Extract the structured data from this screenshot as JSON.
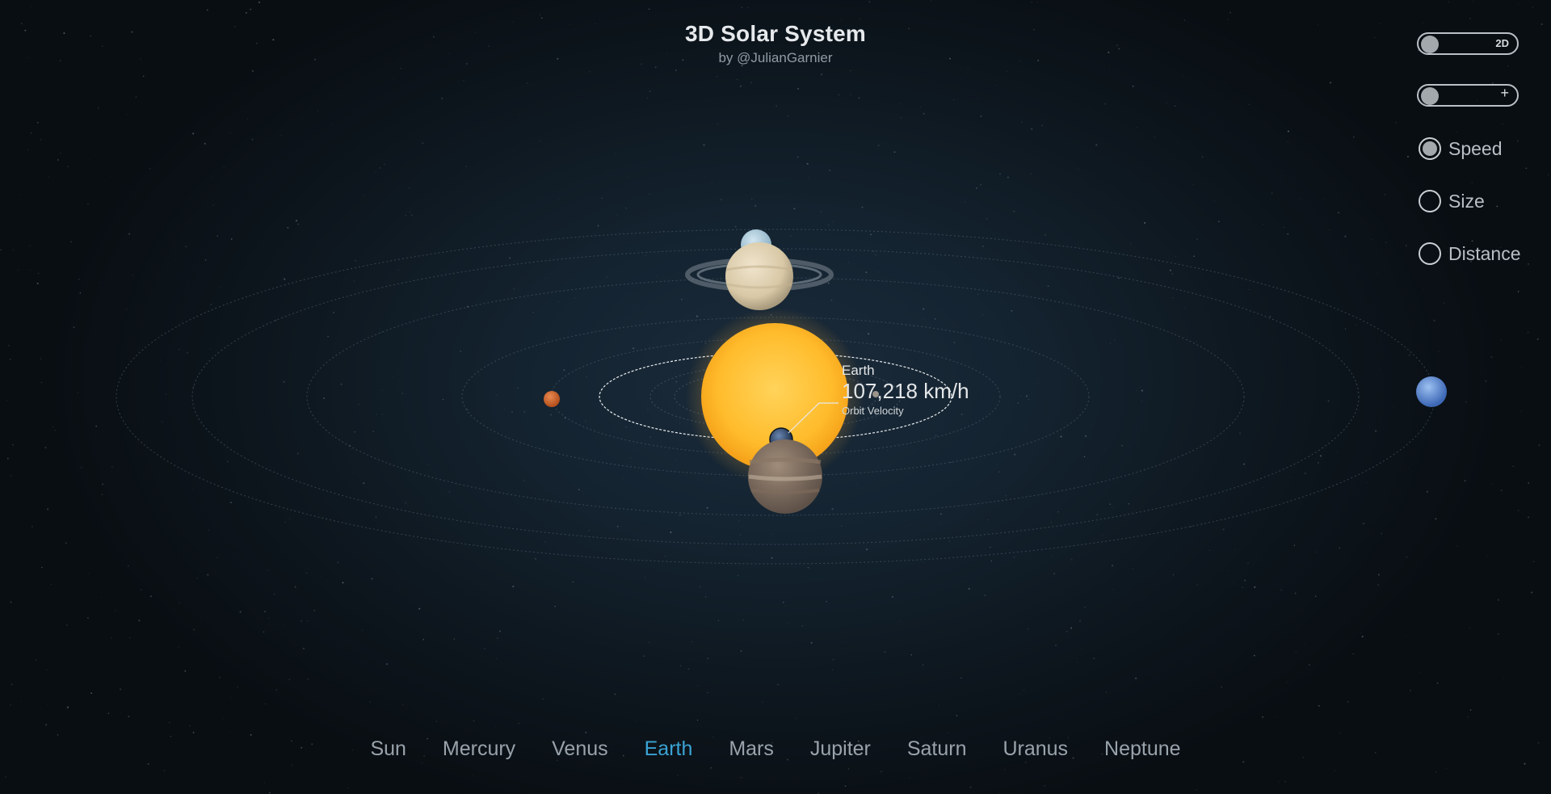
{
  "header": {
    "title": "3D Solar System",
    "byline": "by @JulianGarnier"
  },
  "controls": {
    "view_toggle_label": "2D",
    "zoom_toggle_label": "+",
    "modes": [
      {
        "label": "Speed",
        "selected": true
      },
      {
        "label": "Size",
        "selected": false
      },
      {
        "label": "Distance",
        "selected": false
      }
    ]
  },
  "info": {
    "planet": "Earth",
    "value": "107,218 km/h",
    "metric": "Orbit Velocity"
  },
  "nav": {
    "items": [
      "Sun",
      "Mercury",
      "Venus",
      "Earth",
      "Mars",
      "Jupiter",
      "Saturn",
      "Uranus",
      "Neptune"
    ],
    "active": "Earth"
  },
  "colors": {
    "accent": "#3aa3d4",
    "sun": "#ffbe32",
    "text": "#e6e9ec"
  }
}
